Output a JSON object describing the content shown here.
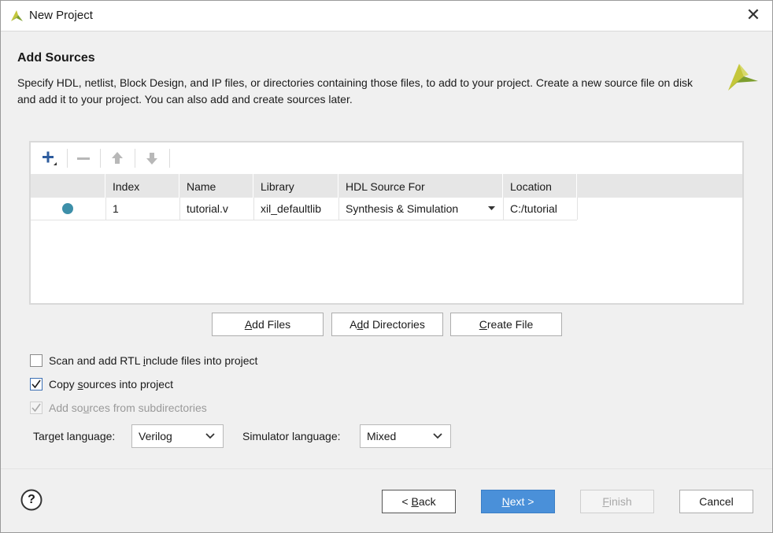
{
  "window": {
    "title": "New Project",
    "close_glyph": "✕"
  },
  "header": {
    "title": "Add Sources",
    "description": "Specify HDL, netlist, Block Design, and IP files, or directories containing those files, to add to your project. Create a new source file on disk and add it to your project. You can also add and create sources later."
  },
  "toolbar": {
    "icons": [
      "add-icon",
      "remove-icon",
      "move-up-icon",
      "move-down-icon"
    ]
  },
  "table": {
    "columns": [
      "Index",
      "Name",
      "Library",
      "HDL Source For",
      "Location"
    ],
    "rows": [
      {
        "status_icon": "status-dot-icon",
        "index": "1",
        "name": "tutorial.v",
        "library": "xil_defaultlib",
        "hdl_source_for": "Synthesis & Simulation",
        "location": "C:/tutorial"
      }
    ]
  },
  "buttons": {
    "add_files": {
      "pre": "",
      "key": "A",
      "post": "dd Files"
    },
    "add_directories": {
      "pre": "A",
      "key": "d",
      "post": "d Directories"
    },
    "create_file": {
      "pre": "",
      "key": "C",
      "post": "reate File"
    }
  },
  "options": {
    "scan_rtl": {
      "pre": "Scan and add RTL ",
      "key": "i",
      "post": "nclude files into project",
      "checked": false,
      "disabled": false
    },
    "copy_sources": {
      "pre": "Copy ",
      "key": "s",
      "post": "ources into project",
      "checked": true,
      "disabled": false
    },
    "add_subdirs": {
      "pre": "Add so",
      "key": "u",
      "post": "rces from subdirectories",
      "checked": true,
      "disabled": true
    }
  },
  "languages": {
    "target_label": "Target language:",
    "target_value": "Verilog",
    "simulator_label": "Simulator language:",
    "simulator_value": "Mixed"
  },
  "footer": {
    "help_glyph": "?",
    "back": {
      "pre": "< ",
      "key": "B",
      "post": "ack"
    },
    "next": {
      "pre": "",
      "key": "N",
      "post": "ext >"
    },
    "finish": {
      "pre": "",
      "key": "F",
      "post": "inish"
    },
    "cancel_label": "Cancel"
  },
  "colors": {
    "accent": "#4a90d9",
    "status_dot": "#3d8fa9",
    "logo_yellow": "#c4c63a",
    "logo_green": "#7d9e2e"
  }
}
